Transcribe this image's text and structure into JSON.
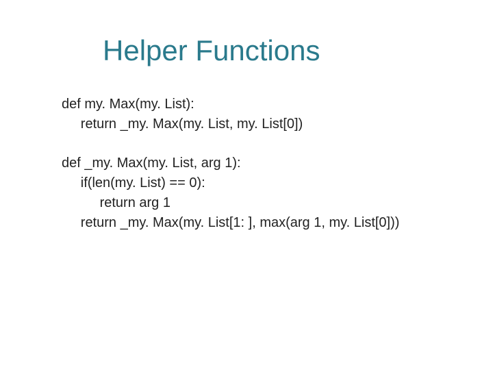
{
  "title": "Helper Functions",
  "code": {
    "block1": {
      "line1": "def my. Max(my. List):",
      "line2": "     return _my. Max(my. List, my. List[0])"
    },
    "block2": {
      "line1": "def _my. Max(my. List, arg 1):",
      "line2": "     if(len(my. List) == 0):",
      "line3": "          return arg 1",
      "line4": "     return _my. Max(my. List[1: ], max(arg 1, my. List[0]))"
    }
  }
}
